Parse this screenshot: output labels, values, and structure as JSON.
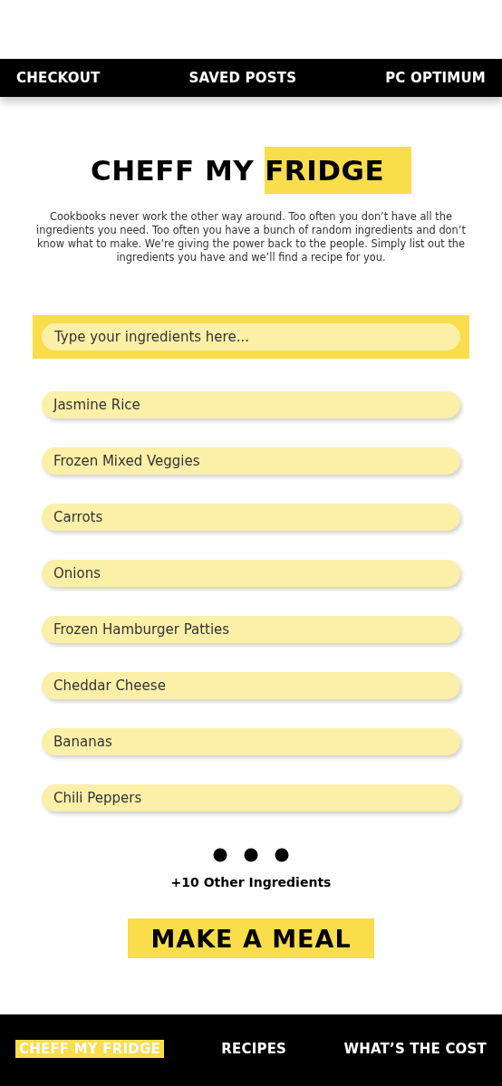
{
  "top_nav": [
    {
      "label": "CHECKOUT"
    },
    {
      "label": "SAVED POSTS"
    },
    {
      "label": "PC OPTIMUM"
    }
  ],
  "title": [
    {
      "text": "CHEFF MY",
      "highlight": false
    },
    {
      "text": "FRIDGE",
      "highlight": true
    }
  ],
  "intro": "Cookbooks never work the other way around. Too often you don’t have all the ingredients you need. Too often you have a bunch of random ingredients and don’t know what to make. We’re giving the power back to the people. Simply list out the ingredients you have and we’ll find a recipe for you.",
  "search": {
    "placeholder": "Type your ingredients here..."
  },
  "ingredients": [
    "Jasmine Rice",
    "Frozen Mixed Veggies",
    "Carrots",
    "Onions",
    "Frozen Hamburger Patties",
    "Cheddar Cheese",
    "Bananas",
    "Chili Peppers"
  ],
  "more": "+10 Other Ingredients",
  "action": "MAKE A MEAL",
  "bottom_nav": [
    {
      "label": "CHEFF MY FRIDGE",
      "selected": true
    },
    {
      "label": "RECIPES",
      "selected": false
    },
    {
      "label": "WHAT’S THE COST",
      "selected": false
    }
  ]
}
